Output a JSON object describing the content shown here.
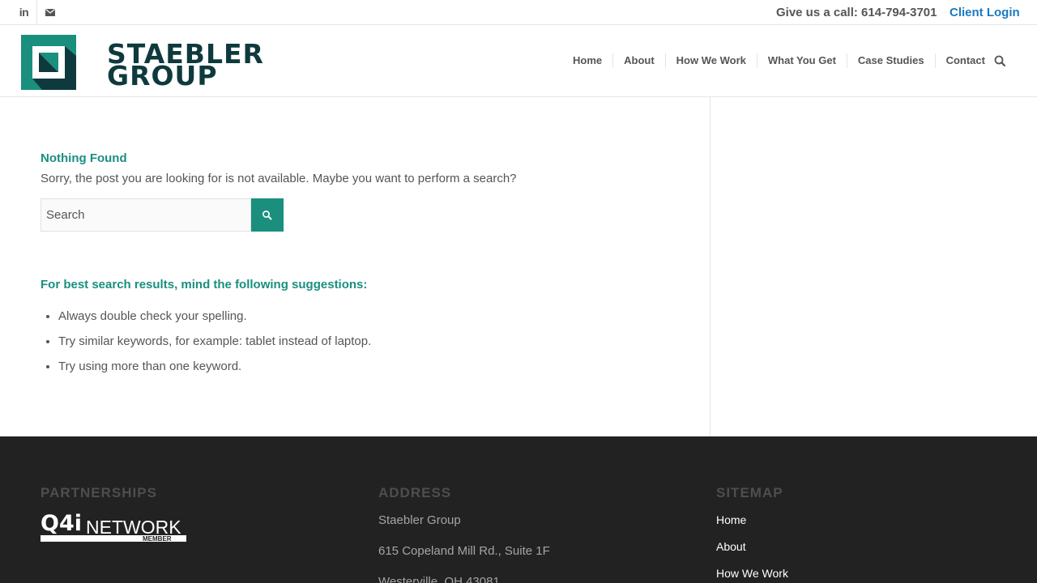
{
  "topbar": {
    "social": [
      {
        "icon": "linkedin-icon",
        "glyph": "in"
      },
      {
        "icon": "mail-icon",
        "glyph": "✉"
      }
    ],
    "phone": "Give us a call: 614-794-3701",
    "client_login": "Client Login"
  },
  "header": {
    "logo_line1": "STAEBLER",
    "logo_line2": "GROUP",
    "nav": [
      "Home",
      "About",
      "How We Work",
      "What You Get",
      "Case Studies",
      "Contact"
    ]
  },
  "main": {
    "title": "Nothing Found",
    "message": "Sorry, the post you are looking for is not available. Maybe you want to perform a search?",
    "search_placeholder": "Search",
    "suggestions_title": "For best search results, mind the following suggestions:",
    "suggestions": [
      "Always double check your spelling.",
      "Try similar keywords, for example: tablet instead of laptop.",
      "Try using more than one keyword."
    ]
  },
  "footer": {
    "partnerships_heading": "PARTNERSHIPS",
    "partner_logo_text": "Q4i",
    "partner_logo_word": "NETWORK",
    "partner_logo_sub": "MEMBER",
    "address_heading": "ADDRESS",
    "address_lines": [
      "Staebler Group",
      "615 Copeland Mill Rd., Suite 1F",
      "Westerville, OH 43081"
    ],
    "sitemap_heading": "SITEMAP",
    "sitemap": [
      "Home",
      "About",
      "How We Work"
    ]
  },
  "colors": {
    "accent": "#1a8f7e",
    "link": "#1a7ac0",
    "logo_dark": "#0f3a3d",
    "footer_bg": "#222222"
  }
}
